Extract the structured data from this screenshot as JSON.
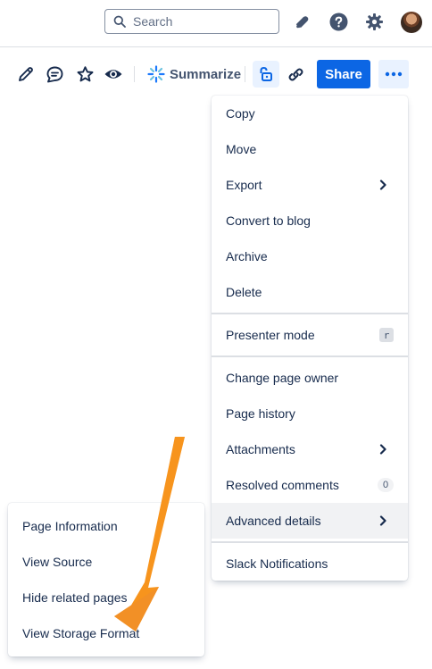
{
  "header": {
    "search": {
      "placeholder": "Search",
      "value": ""
    },
    "icons": [
      "notifications-icon",
      "help-icon",
      "settings-icon"
    ]
  },
  "toolbar": {
    "summarize_label": "Summarize",
    "share_label": "Share",
    "icons": [
      "edit-icon",
      "comment-icon",
      "star-icon",
      "watch-icon",
      "restrictions-icon",
      "link-icon",
      "more-icon"
    ]
  },
  "more_menu": {
    "items": [
      {
        "label": "Copy"
      },
      {
        "label": "Move"
      },
      {
        "label": "Export",
        "submenu": true
      },
      {
        "label": "Convert to blog"
      },
      {
        "label": "Archive"
      },
      {
        "label": "Delete"
      },
      {
        "label": "Presenter mode",
        "shortcut": "r"
      },
      {
        "label": "Change page owner"
      },
      {
        "label": "Page history"
      },
      {
        "label": "Attachments",
        "submenu": true
      },
      {
        "label": "Resolved comments",
        "count": "0"
      },
      {
        "label": "Advanced details",
        "submenu": true,
        "active": true
      },
      {
        "label": "Slack Notifications"
      }
    ]
  },
  "advanced_submenu": {
    "items": [
      {
        "label": "Page Information"
      },
      {
        "label": "View Source"
      },
      {
        "label": "Hide related pages"
      },
      {
        "label": "View Storage Format"
      }
    ]
  },
  "colors": {
    "primary": "#0c66e4",
    "selected_bg": "#e9f2ff",
    "annotation_arrow": "#f7941d"
  }
}
